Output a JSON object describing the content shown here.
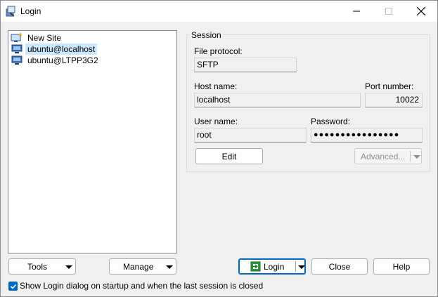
{
  "window": {
    "title": "Login"
  },
  "sites": [
    {
      "label": "New Site",
      "icon": "new-site-icon",
      "selected": false
    },
    {
      "label": "ubuntu@localhost",
      "icon": "computer-icon",
      "selected": true
    },
    {
      "label": "ubuntu@LTPP3G2",
      "icon": "computer-icon",
      "selected": false
    }
  ],
  "session": {
    "group_title": "Session",
    "file_protocol_label": "File protocol:",
    "file_protocol_value": "SFTP",
    "host_name_label": "Host name:",
    "host_name_value": "localhost",
    "port_number_label": "Port number:",
    "port_number_value": "10022",
    "user_name_label": "User name:",
    "user_name_value": "root",
    "password_label": "Password:",
    "password_value": "●●●●●●●●●●●●●●●●",
    "edit_label": "Edit",
    "advanced_label": "Advanced..."
  },
  "buttons": {
    "tools": "Tools",
    "manage": "Manage",
    "login": "Login",
    "close": "Close",
    "help": "Help"
  },
  "options": {
    "show_login_dialog": "Show Login dialog on startup and when the last session is closed",
    "show_login_dialog_checked": true
  },
  "colors": {
    "accent": "#0067c0",
    "selection": "#cce8ff",
    "login_icon": "#2e9b3a"
  }
}
